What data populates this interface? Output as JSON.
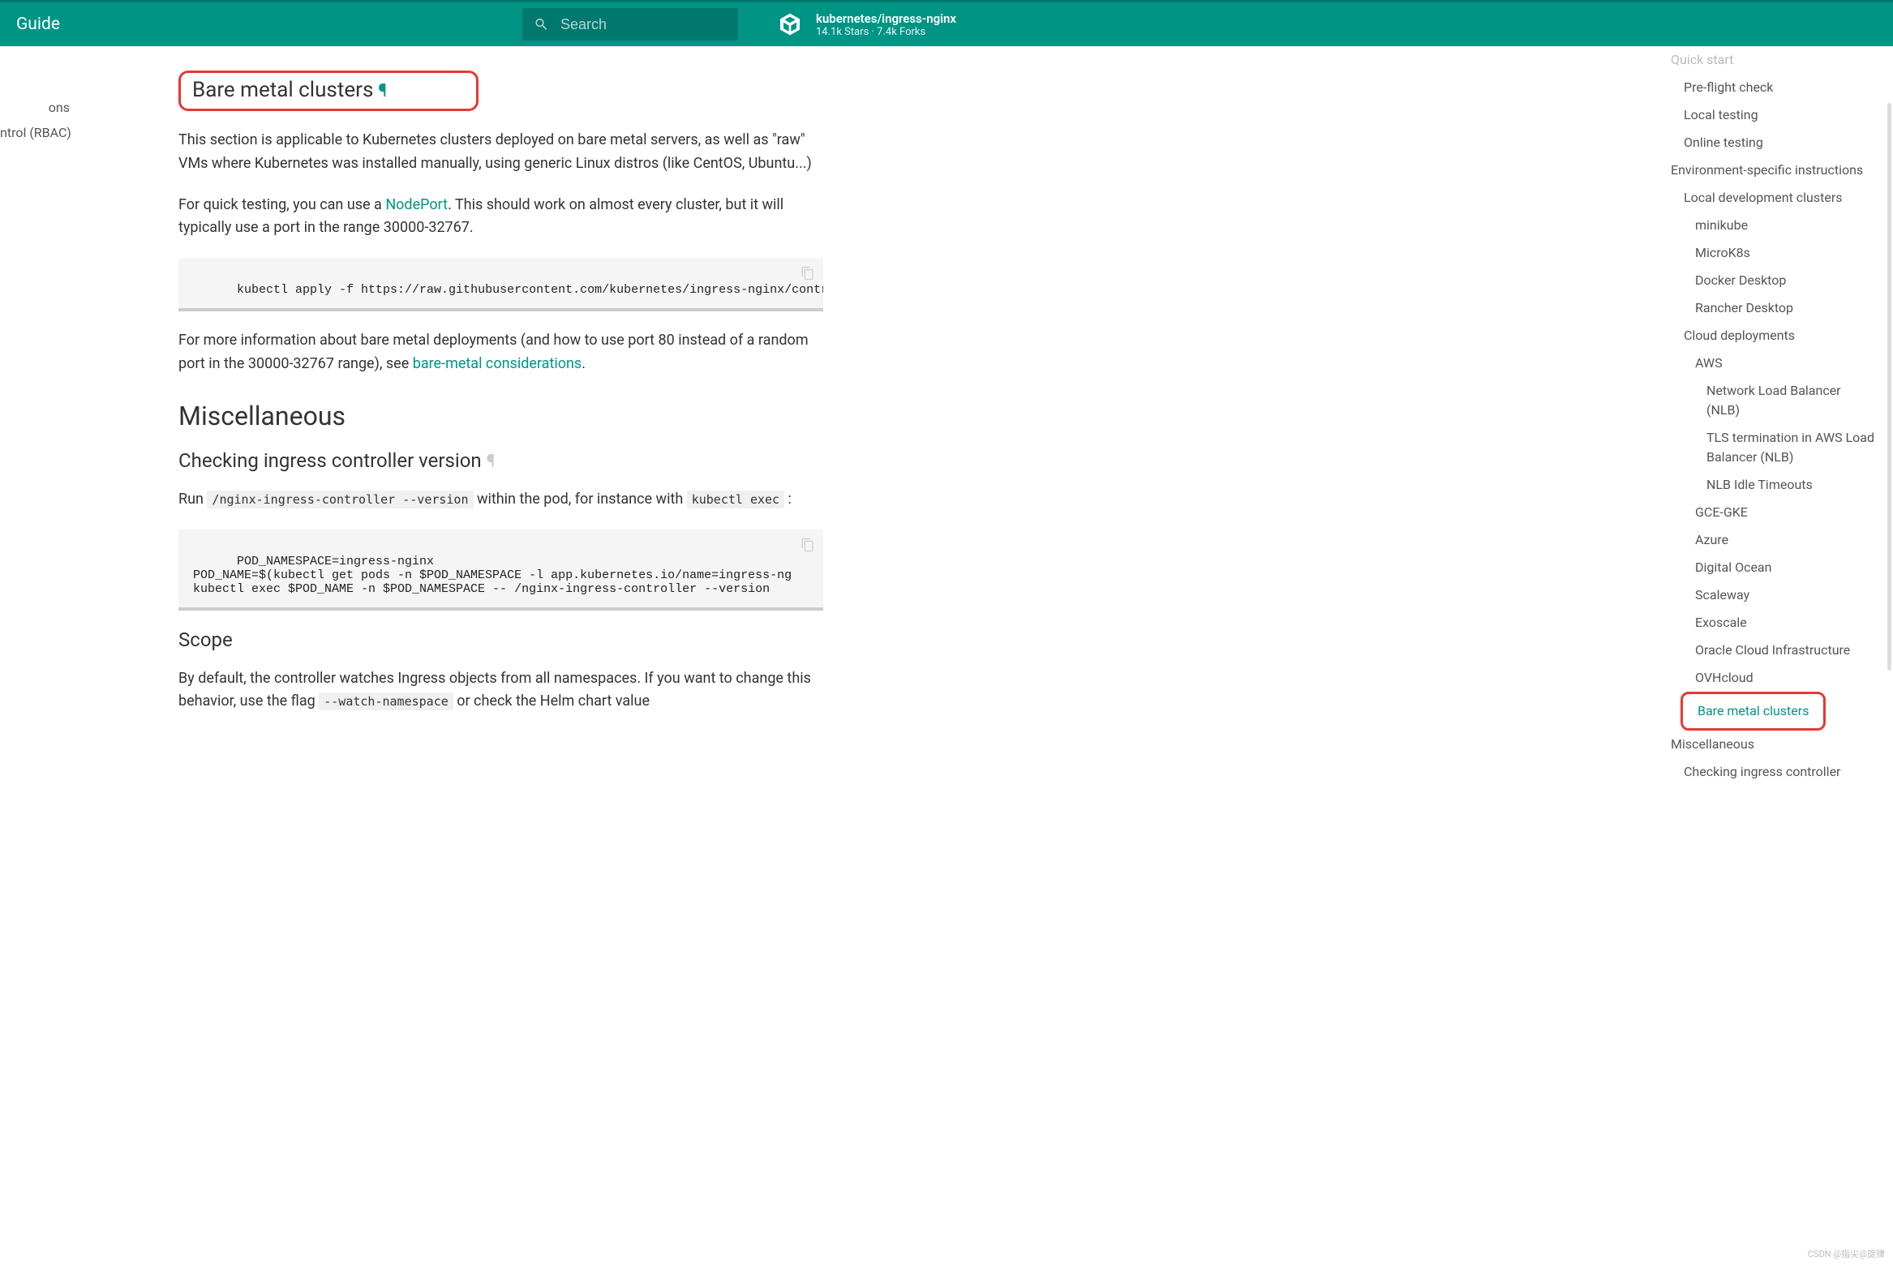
{
  "header": {
    "title": "Guide",
    "search_placeholder": "Search",
    "repo_name": "kubernetes/ingress-nginx",
    "repo_stats": "14.1k Stars · 7.4k Forks"
  },
  "left_nav": {
    "item1": "ons",
    "item2": "ntrol (RBAC)"
  },
  "main": {
    "h_bare_metal": "Bare metal clusters",
    "p_intro": "This section is applicable to Kubernetes clusters deployed on bare metal servers, as well as \"raw\" VMs where Kubernetes was installed manually, using generic Linux distros (like CentOS, Ubuntu...)",
    "p_quick_pre": "For quick testing, you can use a ",
    "link_nodeport": "NodePort",
    "p_quick_post": ". This should work on almost every cluster, but it will typically use a port in the range 30000-32767.",
    "code1": "kubectl apply -f https://raw.githubusercontent.com/kubernetes/ingress-nginx/contro",
    "p_more_pre": "For more information about bare metal deployments (and how to use port 80 instead of a random port in the 30000-32767 range), see ",
    "link_baremetal": "bare-metal considerations",
    "p_more_post": ".",
    "h_misc": "Miscellaneous",
    "h_checking": "Checking ingress controller version",
    "p_run_pre": "Run ",
    "code_version": "/nginx-ingress-controller --version",
    "p_run_mid": " within the pod, for instance with ",
    "code_exec": "kubectl exec",
    "p_run_post": " :",
    "code2": "POD_NAMESPACE=ingress-nginx\nPOD_NAME=$(kubectl get pods -n $POD_NAMESPACE -l app.kubernetes.io/name=ingress-ng\nkubectl exec $POD_NAME -n $POD_NAMESPACE -- /nginx-ingress-controller --version",
    "h_scope": "Scope",
    "p_scope_pre": "By default, the controller watches Ingress objects from all namespaces. If you want to change this behavior, use the flag ",
    "code_watch": "--watch-namespace",
    "p_scope_post": " or check the Helm chart value"
  },
  "toc": {
    "i0": "Quick start",
    "i1": "Pre-flight check",
    "i2": "Local testing",
    "i3": "Online testing",
    "i4": "Environment-specific instructions",
    "i5": "Local development clusters",
    "i6": "minikube",
    "i7": "MicroK8s",
    "i8": "Docker Desktop",
    "i9": "Rancher Desktop",
    "i10": "Cloud deployments",
    "i11": "AWS",
    "i12": "Network Load Balancer (NLB)",
    "i13": "TLS termination in AWS Load Balancer (NLB)",
    "i14": "NLB Idle Timeouts",
    "i15": "GCE-GKE",
    "i16": "Azure",
    "i17": "Digital Ocean",
    "i18": "Scaleway",
    "i19": "Exoscale",
    "i20": "Oracle Cloud Infrastructure",
    "i21": "OVHcloud",
    "i22": "Bare metal clusters",
    "i23": "Miscellaneous",
    "i24": "Checking ingress controller"
  },
  "watermark": "CSDN @指尖@旋律"
}
